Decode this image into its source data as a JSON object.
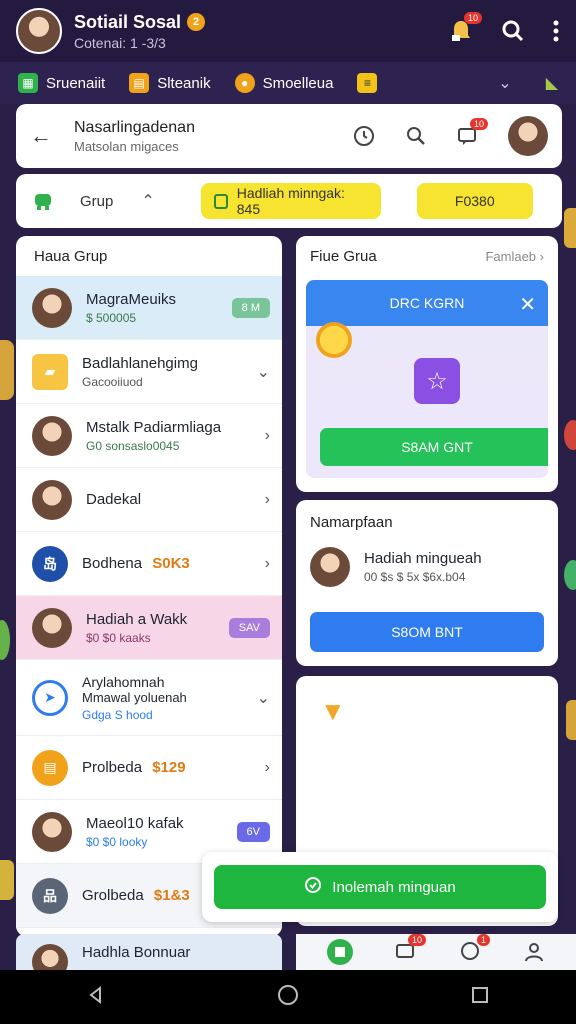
{
  "topbar": {
    "title": "Sotiail Sosal",
    "badge": "2",
    "subtitle": "Cotenai: 1 -3/3",
    "notif_badge": "10"
  },
  "categories": [
    {
      "label": "Sruenaiit",
      "icon": "grid-icon",
      "color": "#2fb24c"
    },
    {
      "label": "Slteanik",
      "icon": "store-icon",
      "color": "#f0a21a"
    },
    {
      "label": "Smoelleua",
      "icon": "burger-icon",
      "color": "#f0a21a"
    }
  ],
  "header": {
    "title": "Nasarlingadenan",
    "subtitle": "Matsolan migaces",
    "chat_badge": "10"
  },
  "tabs": {
    "group_label": "Grup",
    "pill_primary": "Hadliah minngak: 845",
    "pill_secondary": "F0380"
  },
  "left": {
    "heading": "Haua Grup",
    "rows": [
      {
        "title": "MagraMeuiks",
        "sub": "$ 500005",
        "chip": "8 M",
        "chip_color": "#7ac49a"
      },
      {
        "title": "Badlahlanehgimg",
        "sub": "Gacooiiuod"
      },
      {
        "title": "Mstalk Padiarmliaga",
        "sub": "G0 sonsaslo0045"
      },
      {
        "title": "Dadekal"
      },
      {
        "title": "Bodhena",
        "price": "S0K3"
      },
      {
        "title": "Hadiah a Wakk",
        "sub": "$0 $0 kaaks",
        "chip": "SAV",
        "chip_color": "#a87ddc"
      },
      {
        "title": "Arylahomnah",
        "title2": "Mmawal yoluenah",
        "sub": "Gdga S hood"
      },
      {
        "title": "Prolbeda",
        "price": "$129"
      },
      {
        "title": "Maeol10 kafak",
        "sub": "$0 $0 looky",
        "chip": "6V",
        "chip_color": "#6a6ae8"
      },
      {
        "title": "Grolbeda",
        "price": "$1&3"
      }
    ],
    "partial_title": "Hadhla Bonnuar"
  },
  "right": {
    "panel1_title": "Fiue Grua",
    "panel1_link": "Famlaeb",
    "promo_bar": "DRC KGRN",
    "promo_button": "S8AM GNT",
    "panel2_title": "Namarpfaan",
    "panel2_row_title": "Hadiah mingueah",
    "panel2_row_sub": "00 $s $ 5x $6x.b04",
    "panel2_button": "S8OM BNT"
  },
  "cta": {
    "label": "Inolemah minguan"
  },
  "bottom_badges": {
    "a": "10",
    "b": "1"
  },
  "colors": {
    "accent_green": "#25c159",
    "accent_blue": "#2f7cf0",
    "accent_yellow": "#f7e431",
    "header_bg": "#241a3f"
  }
}
